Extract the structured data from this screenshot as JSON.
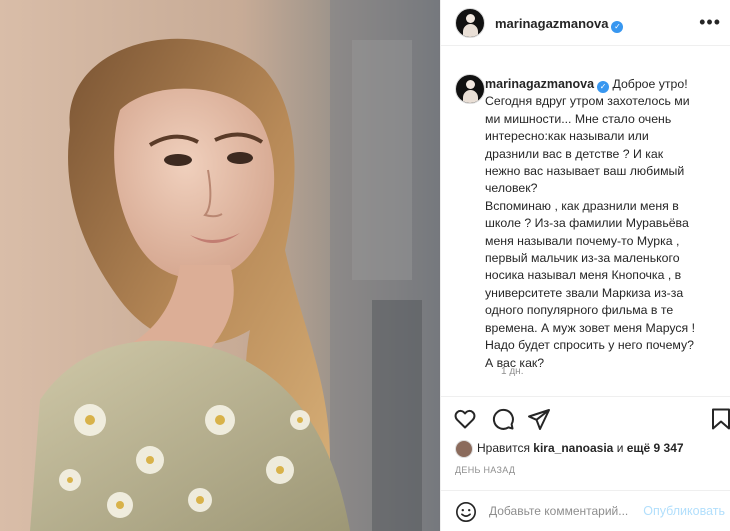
{
  "post": {
    "image_alt": "photo",
    "author": "marinagazmanova",
    "verified": true,
    "caption_lines": [
      "Доброе утро!",
      "Сегодня вдруг утром захотелось ми",
      "ми мишности... Мне стало очень",
      "интересно:как называли или",
      "дразнили вас в детстве ? И как",
      "нежно вас называет ваш любимый",
      "человек?",
      "Вспоминаю , как дразнили меня в",
      "школе ? Из-за фамилии Муравьёва",
      "меня называли почему-то Мурка ,",
      "первый мальчик из-за маленького",
      "носика называл меня Кнопочка , в",
      "университете звали Маркиза из-за",
      "одного популярного фильма в те",
      "времена. А муж зовет меня Маруся !",
      "Надо будет спросить у него почему?",
      "А вас как?"
    ],
    "time_ago": "1 дн.",
    "likes": {
      "prefix": "Нравится",
      "user": "kira_nanoasia",
      "middle": "и",
      "count_text": "ещё 9 347"
    },
    "date_label": "ДЕНЬ НАЗАД"
  },
  "header": {
    "username": "marinagazmanova",
    "more_glyph": "•••"
  },
  "icons": {
    "like": "heart-icon",
    "comment": "comment-icon",
    "share": "share-icon",
    "save": "bookmark-icon",
    "emoji": "emoji-icon"
  },
  "comment": {
    "placeholder": "Добавьте комментарий...",
    "publish_label": "Опубликовать"
  },
  "colors": {
    "verified": "#3897f0",
    "publish_disabled": "#b2dffc"
  }
}
